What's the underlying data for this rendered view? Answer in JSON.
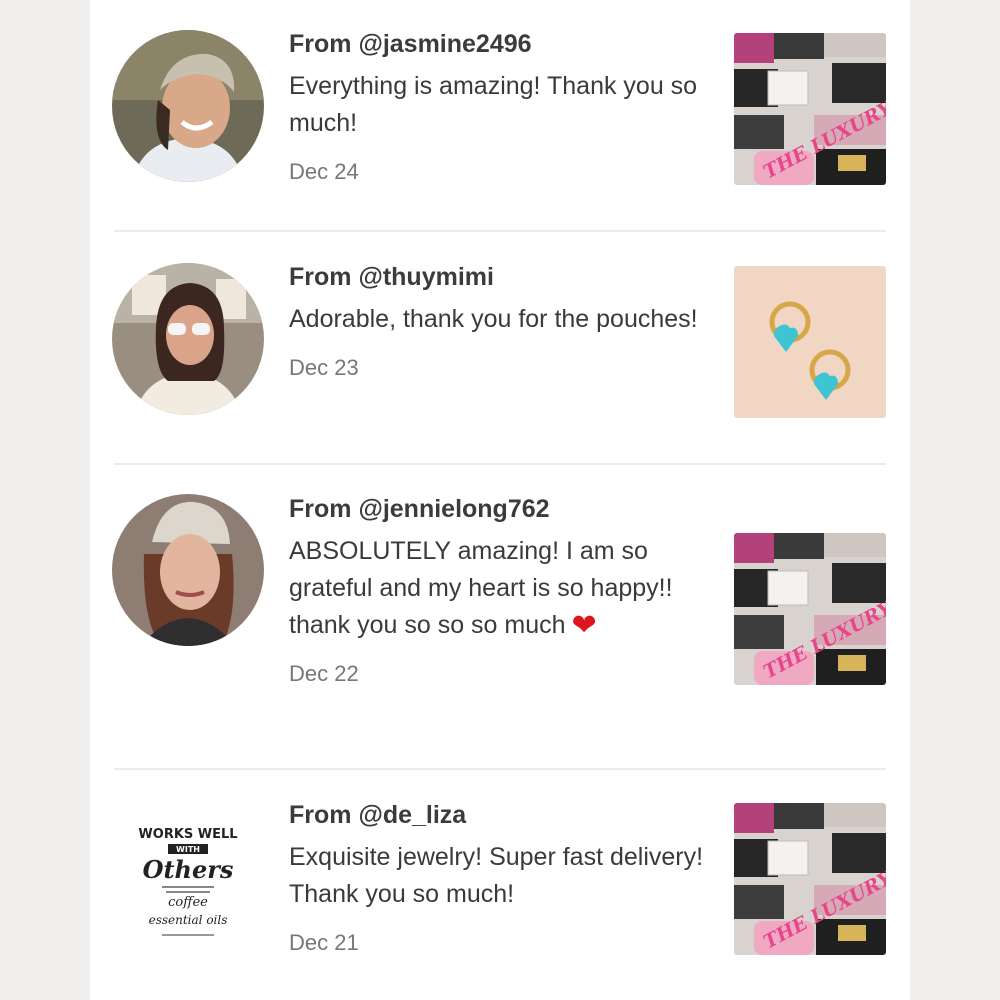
{
  "reviews": [
    {
      "username": "From @jasmine2496",
      "message": "Everything is amazing! Thank you so much!",
      "date": "Dec 24",
      "item_thumbnail": "luxury-loop-bags-photo",
      "watermark_text": "THE LUXURY LOOP LOVE THEM",
      "avatar": "user-photo"
    },
    {
      "username": "From @thuymimi",
      "message": "Adorable, thank you for the pouches!",
      "date": "Dec 23",
      "item_thumbnail": "turquoise-heart-earrings-photo",
      "avatar": "user-photo"
    },
    {
      "username": "From @jennielong762",
      "message": "ABSOLUTELY amazing! I am so grateful and my heart is so happy!! thank you so so so much",
      "emoji": "❤",
      "date": "Dec 22",
      "item_thumbnail": "luxury-loop-bags-photo",
      "watermark_text": "THE LUXURY LOOP LOVE THEM",
      "avatar": "user-photo"
    },
    {
      "username": "From @de_liza",
      "message": "Exquisite jewelry! Super fast delivery! Thank you so much!",
      "date": "Dec 21",
      "item_thumbnail": "luxury-loop-bags-photo",
      "watermark_text": "THE LUXURY LOOP LOVE THEM",
      "avatar": "works-well-with-others-logo",
      "avatar_text": {
        "top": "WORKS WELL",
        "middle": "WITH",
        "script": "Others",
        "coffee": "coffee",
        "oils": "essential oils"
      }
    }
  ],
  "colors": {
    "background": "#f1efee",
    "panel": "#ffffff",
    "text": "#3a3a3a",
    "date": "#777777",
    "divider": "#ececec",
    "heart": "#e0151b",
    "watermark": "#e8458a"
  }
}
